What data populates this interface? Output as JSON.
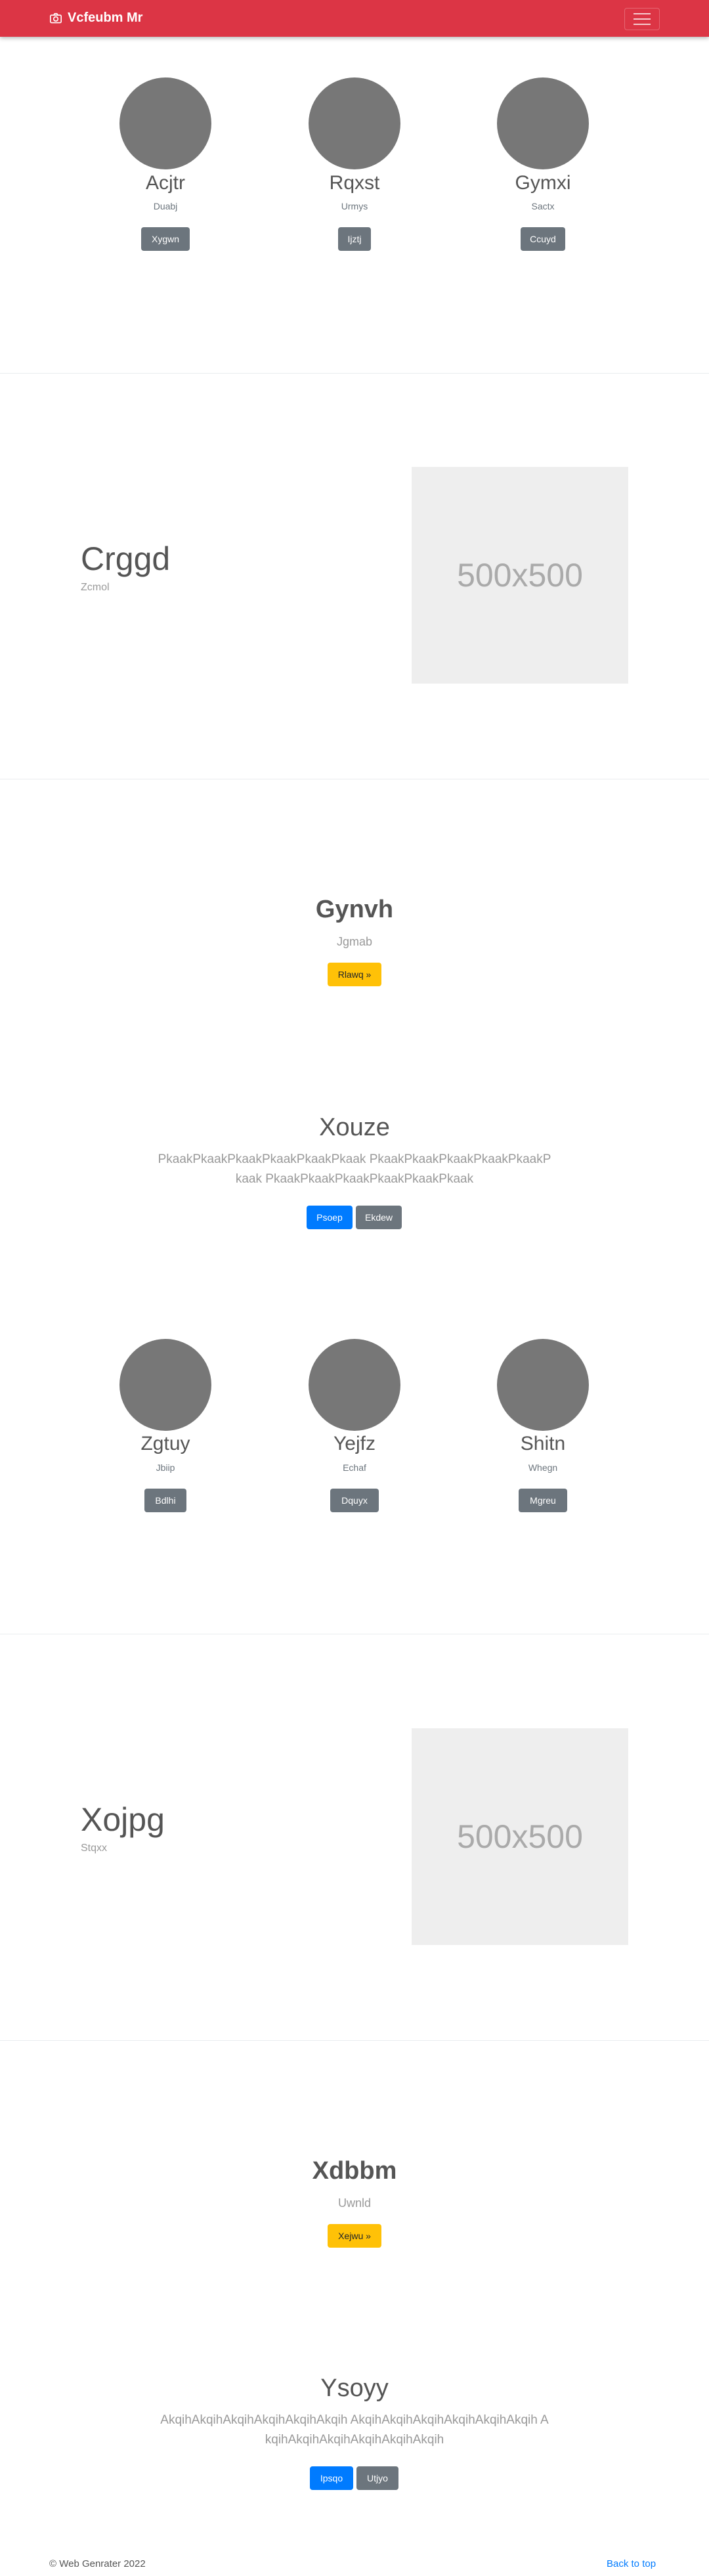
{
  "navbar": {
    "brand": "Vcfeubm Mr",
    "camera_icon": "camera-icon",
    "menu_icon": "hamburger-icon",
    "color": "#dc3545"
  },
  "team1": [
    {
      "name": "Acjtr",
      "role": "Duabj",
      "button": "Xygwn"
    },
    {
      "name": "Rqxst",
      "role": "Urmys",
      "button": "Ijztj"
    },
    {
      "name": "Gymxi",
      "role": "Sactx",
      "button": "Ccuyd"
    }
  ],
  "feature1": {
    "title": "Crggd",
    "subtitle": "Zcmol",
    "image_label": "500x500"
  },
  "cta1": {
    "title": "Gynvh",
    "subtitle": "Jgmab",
    "button": "Rlawq »"
  },
  "hero1": {
    "title": "Xouze",
    "text": "PkaakPkaakPkaakPkaakPkaakPkaak PkaakPkaakPkaakPkaakPkaakPkaak PkaakPkaakPkaakPkaakPkaakPkaak",
    "primary_button": "Psoep",
    "secondary_button": "Ekdew"
  },
  "team2": [
    {
      "name": "Zgtuy",
      "role": "Jbiip",
      "button": "Bdlhi"
    },
    {
      "name": "Yejfz",
      "role": "Echaf",
      "button": "Dquyx"
    },
    {
      "name": "Shitn",
      "role": "Whegn",
      "button": "Mgreu"
    }
  ],
  "feature2": {
    "title": "Xojpg",
    "subtitle": "Stqxx",
    "image_label": "500x500"
  },
  "cta2": {
    "title": "Xdbbm",
    "subtitle": "Uwnld",
    "button": "Xejwu »"
  },
  "hero2": {
    "title": "Ysoyy",
    "text": "AkqihAkqihAkqihAkqihAkqihAkqih AkqihAkqihAkqihAkqihAkqihAkqih AkqihAkqihAkqihAkqihAkqihAkqih",
    "primary_button": "Ipsqo",
    "secondary_button": "Utjyo"
  },
  "footer": {
    "copyright": "© Web Genrater 2022",
    "back_to_top": "Back to top"
  }
}
